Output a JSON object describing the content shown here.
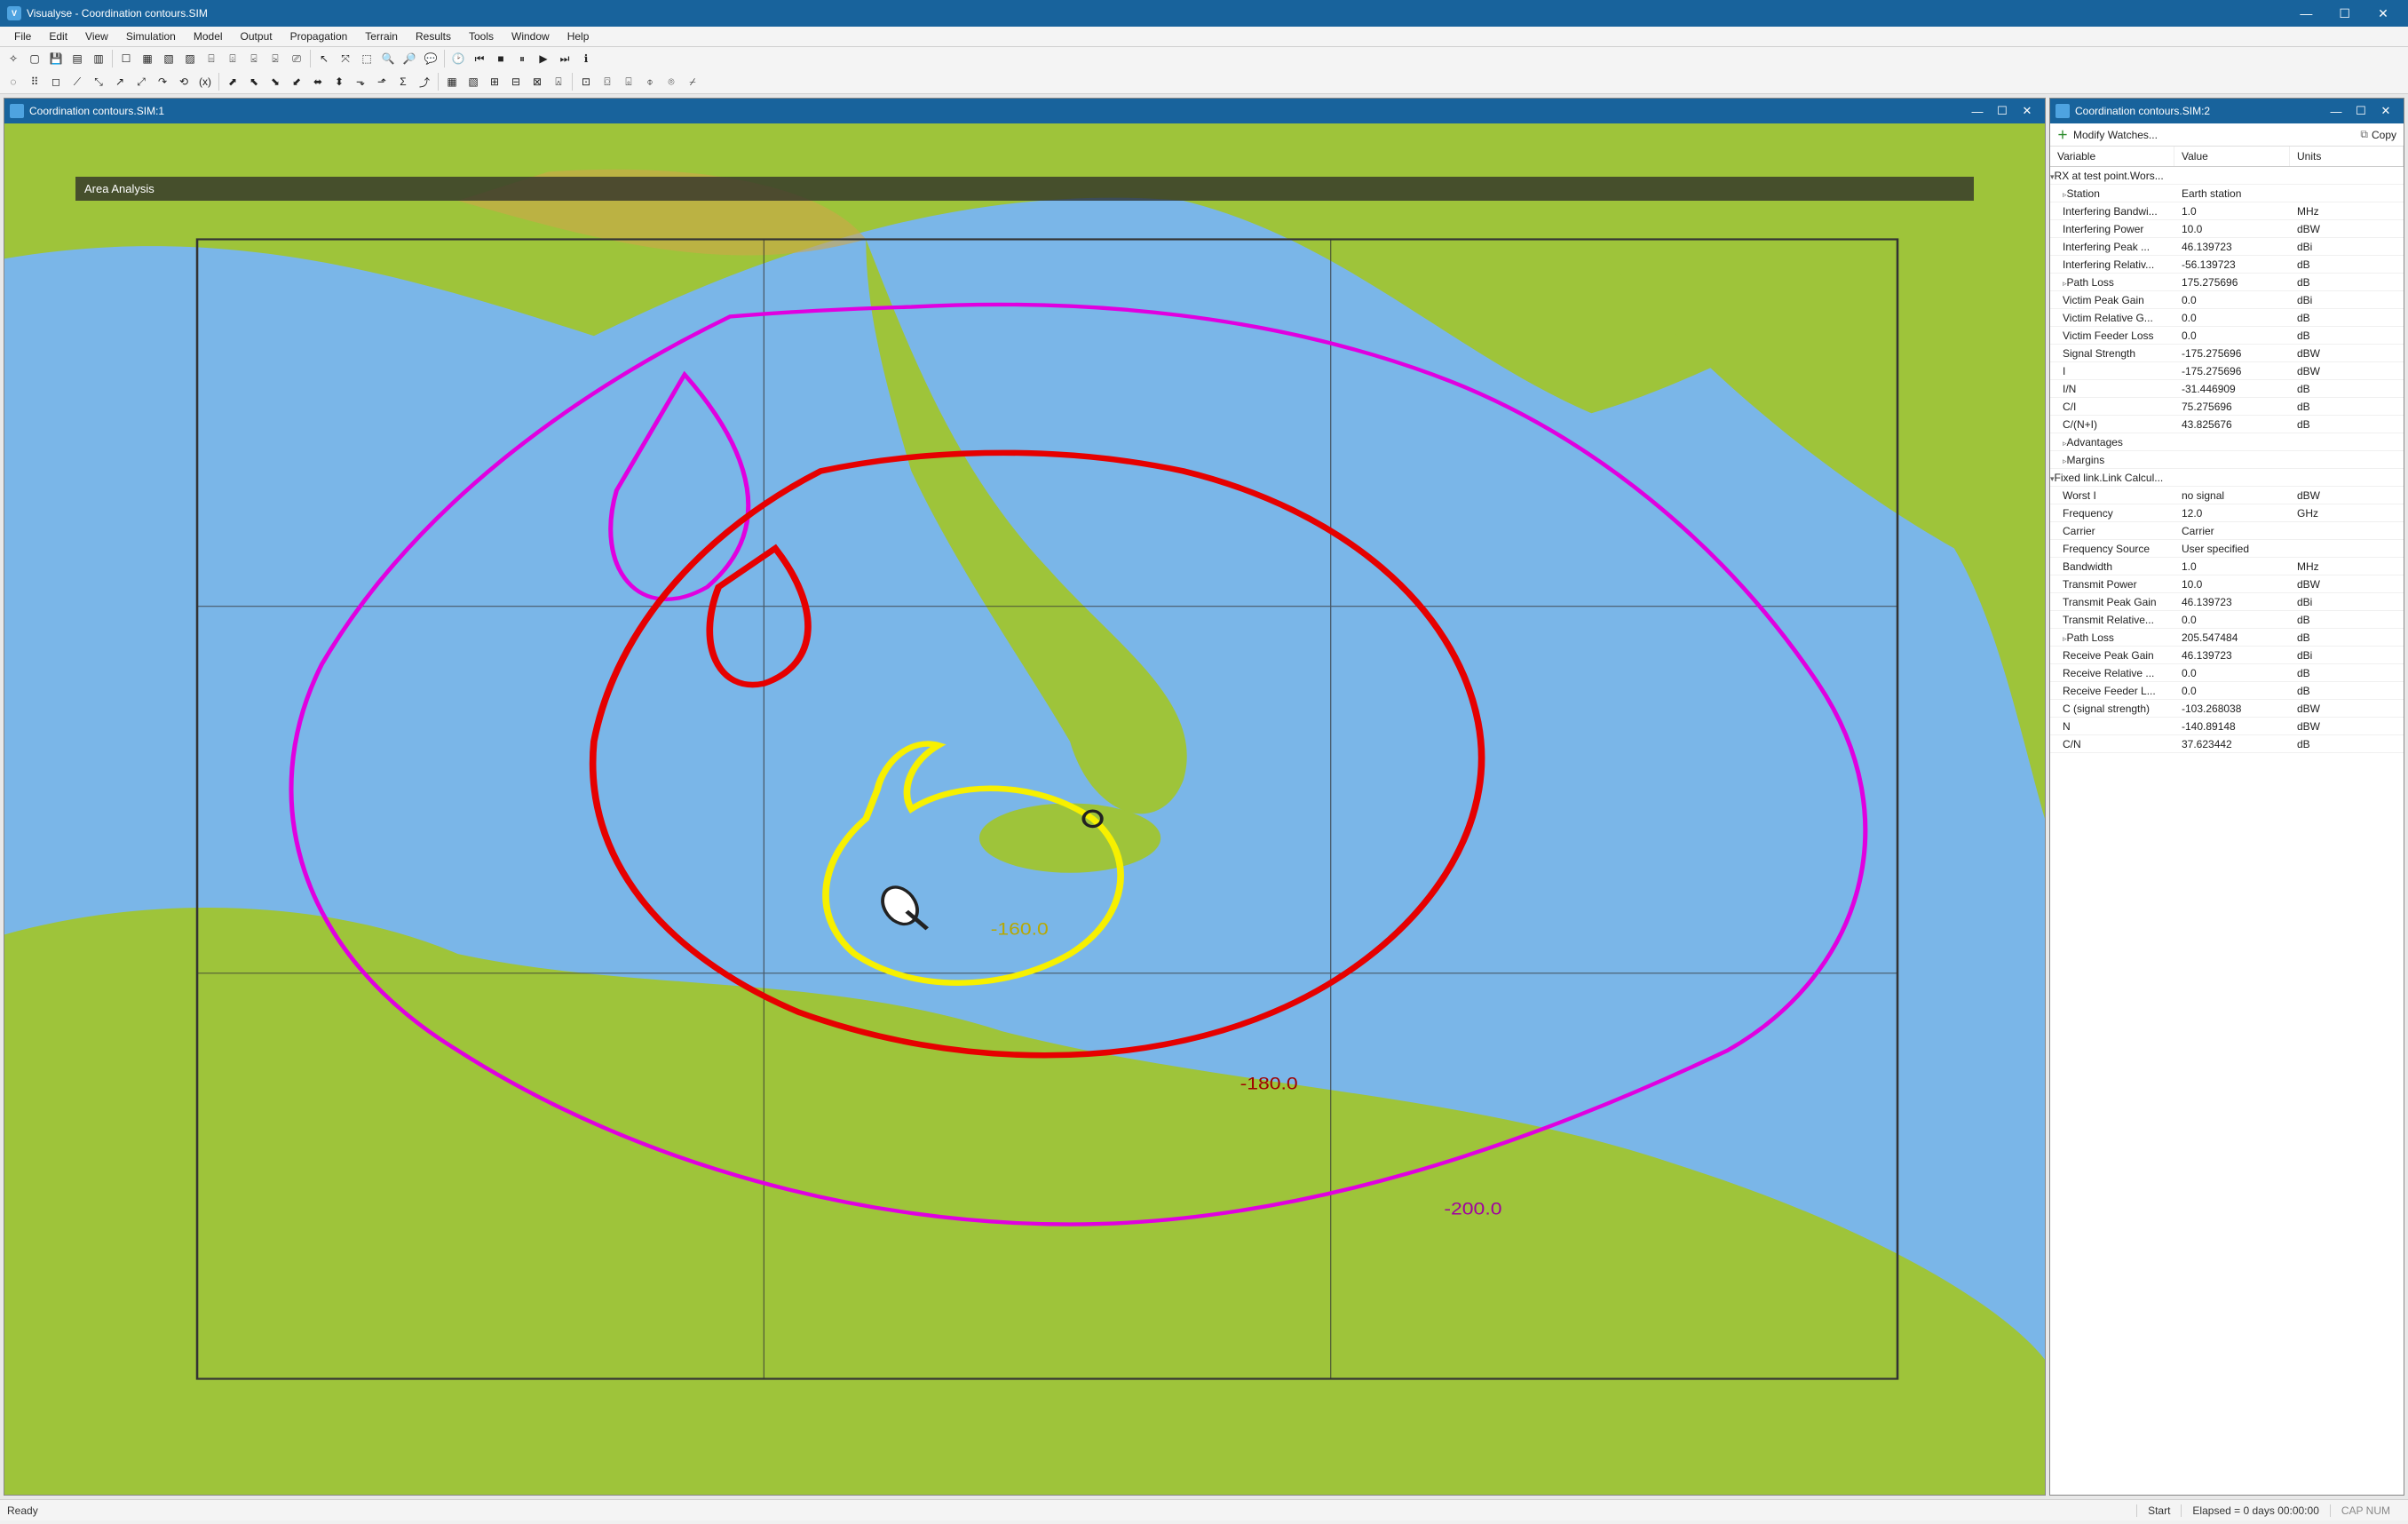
{
  "app": {
    "title": "Visualyse - Coordination contours.SIM"
  },
  "menu": [
    "File",
    "Edit",
    "View",
    "Simulation",
    "Model",
    "Output",
    "Propagation",
    "Terrain",
    "Results",
    "Tools",
    "Window",
    "Help"
  ],
  "map_panel": {
    "title": "Coordination contours.SIM:1",
    "overlay_label": "Area Analysis",
    "contours": {
      "yellow_label": "-160.0",
      "red_label": "-180.0",
      "magenta_label": "-200.0"
    }
  },
  "watch_panel": {
    "title": "Coordination contours.SIM:2",
    "modify_label": "Modify Watches...",
    "copy_label": "Copy",
    "headers": {
      "variable": "Variable",
      "value": "Value",
      "units": "Units"
    }
  },
  "watches": [
    {
      "type": "group",
      "twisty": "▾",
      "indent": 0,
      "variable": "RX at test point.Wors...",
      "value": "",
      "units": ""
    },
    {
      "type": "row",
      "twisty": "▹",
      "indent": 1,
      "variable": "Station",
      "value": "Earth station",
      "units": ""
    },
    {
      "type": "row",
      "twisty": "",
      "indent": 1,
      "variable": "Interfering Bandwi...",
      "value": "1.0",
      "units": "MHz"
    },
    {
      "type": "row",
      "twisty": "",
      "indent": 1,
      "variable": "Interfering Power",
      "value": "10.0",
      "units": "dBW"
    },
    {
      "type": "row",
      "twisty": "",
      "indent": 1,
      "variable": "Interfering Peak ...",
      "value": "46.139723",
      "units": "dBi"
    },
    {
      "type": "row",
      "twisty": "",
      "indent": 1,
      "variable": "Interfering Relativ...",
      "value": "-56.139723",
      "units": "dB"
    },
    {
      "type": "row",
      "twisty": "▹",
      "indent": 1,
      "variable": "Path Loss",
      "value": "175.275696",
      "units": "dB"
    },
    {
      "type": "row",
      "twisty": "",
      "indent": 1,
      "variable": "Victim Peak Gain",
      "value": "0.0",
      "units": "dBi"
    },
    {
      "type": "row",
      "twisty": "",
      "indent": 1,
      "variable": "Victim Relative G...",
      "value": "0.0",
      "units": "dB"
    },
    {
      "type": "row",
      "twisty": "",
      "indent": 1,
      "variable": "Victim Feeder Loss",
      "value": "0.0",
      "units": "dB"
    },
    {
      "type": "row",
      "twisty": "",
      "indent": 1,
      "variable": "Signal Strength",
      "value": "-175.275696",
      "units": "dBW"
    },
    {
      "type": "row",
      "twisty": "",
      "indent": 1,
      "variable": "I",
      "value": "-175.275696",
      "units": "dBW"
    },
    {
      "type": "row",
      "twisty": "",
      "indent": 1,
      "variable": "I/N",
      "value": "-31.446909",
      "units": "dB"
    },
    {
      "type": "row",
      "twisty": "",
      "indent": 1,
      "variable": "C/I",
      "value": "75.275696",
      "units": "dB"
    },
    {
      "type": "row",
      "twisty": "",
      "indent": 1,
      "variable": "C/(N+I)",
      "value": "43.825676",
      "units": "dB"
    },
    {
      "type": "row",
      "twisty": "▹",
      "indent": 1,
      "variable": "Advantages",
      "value": "",
      "units": ""
    },
    {
      "type": "row",
      "twisty": "▹",
      "indent": 1,
      "variable": "Margins",
      "value": "",
      "units": ""
    },
    {
      "type": "group",
      "twisty": "▾",
      "indent": 0,
      "variable": "Fixed link.Link Calcul...",
      "value": "",
      "units": ""
    },
    {
      "type": "row",
      "twisty": "",
      "indent": 1,
      "variable": "Worst I",
      "value": "no signal",
      "units": "dBW"
    },
    {
      "type": "row",
      "twisty": "",
      "indent": 1,
      "variable": "Frequency",
      "value": "12.0",
      "units": "GHz"
    },
    {
      "type": "row",
      "twisty": "",
      "indent": 1,
      "variable": "Carrier",
      "value": "Carrier",
      "units": ""
    },
    {
      "type": "row",
      "twisty": "",
      "indent": 1,
      "variable": "Frequency Source",
      "value": "User specified",
      "units": ""
    },
    {
      "type": "row",
      "twisty": "",
      "indent": 1,
      "variable": "Bandwidth",
      "value": "1.0",
      "units": "MHz"
    },
    {
      "type": "row",
      "twisty": "",
      "indent": 1,
      "variable": "Transmit Power",
      "value": "10.0",
      "units": "dBW"
    },
    {
      "type": "row",
      "twisty": "",
      "indent": 1,
      "variable": "Transmit Peak Gain",
      "value": "46.139723",
      "units": "dBi"
    },
    {
      "type": "row",
      "twisty": "",
      "indent": 1,
      "variable": "Transmit Relative...",
      "value": "0.0",
      "units": "dB"
    },
    {
      "type": "row",
      "twisty": "▹",
      "indent": 1,
      "variable": "Path Loss",
      "value": "205.547484",
      "units": "dB"
    },
    {
      "type": "row",
      "twisty": "",
      "indent": 1,
      "variable": "Receive Peak Gain",
      "value": "46.139723",
      "units": "dBi"
    },
    {
      "type": "row",
      "twisty": "",
      "indent": 1,
      "variable": "Receive Relative ...",
      "value": "0.0",
      "units": "dB"
    },
    {
      "type": "row",
      "twisty": "",
      "indent": 1,
      "variable": "Receive Feeder L...",
      "value": "0.0",
      "units": "dB"
    },
    {
      "type": "row",
      "twisty": "",
      "indent": 1,
      "variable": "C (signal strength)",
      "value": "-103.268038",
      "units": "dBW"
    },
    {
      "type": "row",
      "twisty": "",
      "indent": 1,
      "variable": "N",
      "value": "-140.89148",
      "units": "dBW"
    },
    {
      "type": "row",
      "twisty": "",
      "indent": 1,
      "variable": "C/N",
      "value": "37.623442",
      "units": "dB"
    }
  ],
  "status": {
    "ready": "Ready",
    "start": "Start",
    "elapsed": "Elapsed = 0 days 00:00:00",
    "caps": "CAP NUM"
  },
  "colors": {
    "accent": "#18639c",
    "yellow": "#f7f000",
    "red": "#e60000",
    "magenta": "#e000e0",
    "sea": "#7ab6e8",
    "land_low": "#9ec43a",
    "land_hi": "#cfa64a"
  }
}
